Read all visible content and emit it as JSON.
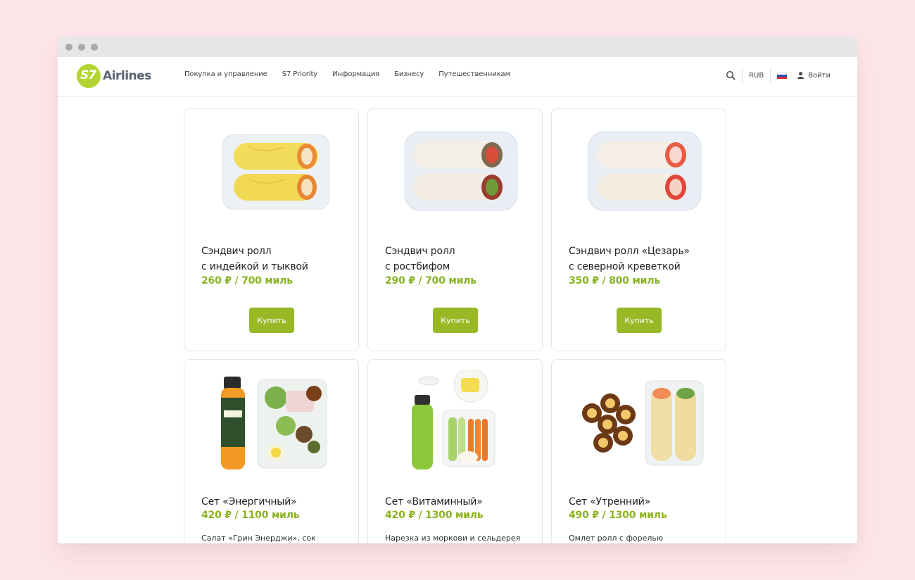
{
  "header": {
    "logo_text": "Airlines",
    "logo_mark": "S7",
    "nav": [
      "Покупка и управление",
      "S7 Priority",
      "Информация",
      "Бизнесу",
      "Путешественникам"
    ],
    "currency": "RUB",
    "login_label": "Войти",
    "icons": {
      "search": "search-icon",
      "user": "user-icon",
      "language": "russian-flag-icon"
    }
  },
  "products": [
    {
      "title": "Сэндвич ролл\nс индейкой и тыквой",
      "price": "260 ₽ / 700 миль",
      "buy_label": "Купить"
    },
    {
      "title": "Сэндвич ролл\nс ростбифом",
      "price": "290 ₽ / 700 миль",
      "buy_label": "Купить"
    },
    {
      "title": "Сэндвич ролл «Цезарь»\nс северной креветкой",
      "price": "350 ₽ / 800 миль",
      "buy_label": "Купить"
    },
    {
      "title": "Сет «Энергичный»",
      "price": "420 ₽ / 1100 миль",
      "desc": "Салат «Грин Энерджи», сок"
    },
    {
      "title": "Сет «Витаминный»",
      "price": "420 ₽ / 1300 миль",
      "desc": "Нарезка из моркови и сельдерея"
    },
    {
      "title": "Сет «Утренний»",
      "price": "490 ₽ / 1300 миль",
      "desc": "Омлет ролл с форелью"
    }
  ],
  "colors": {
    "accent": "#98b826",
    "price": "#8ab320",
    "logo": "#b4d334",
    "background": "#fde6ea"
  }
}
